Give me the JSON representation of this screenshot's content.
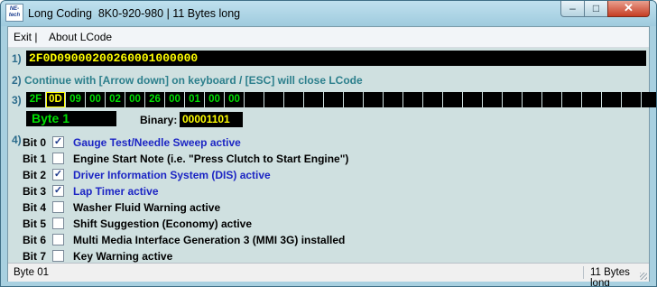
{
  "window": {
    "icon_text": "NE-tech",
    "title": "Long Coding  8K0-920-980 | 11 Bytes long",
    "minimize": "–",
    "maximize": "□",
    "close": "✕"
  },
  "menu": {
    "exit": "Exit |",
    "about": "About LCode"
  },
  "steps": {
    "s1": "1)",
    "s2": "2)",
    "s3": "3)",
    "s4": "4)"
  },
  "coding_string": "2F0D09000200260001000000",
  "instruction": "Continue with [Arrow down] on keyboard / [ESC] will close LCode",
  "bytes": [
    "2F",
    "0D",
    "09",
    "00",
    "02",
    "00",
    "26",
    "00",
    "01",
    "00",
    "00",
    "",
    "",
    "",
    "",
    "",
    "",
    "",
    "",
    "",
    "",
    "",
    "",
    "",
    "",
    "",
    "",
    "",
    "",
    "",
    "",
    ""
  ],
  "selected_byte_index": 1,
  "byte_label": "Byte 1",
  "binary_label": "Binary:",
  "binary_value": "00001101",
  "bits": [
    {
      "name": "Bit 0",
      "checked": true,
      "mark": "✓",
      "desc": "Gauge Test/Needle Sweep active"
    },
    {
      "name": "Bit 1",
      "checked": false,
      "mark": "",
      "desc": "Engine Start Note (i.e. \"Press Clutch to Start Engine\")"
    },
    {
      "name": "Bit 2",
      "checked": true,
      "mark": "✓",
      "desc": "Driver Information System (DIS) active"
    },
    {
      "name": "Bit 3",
      "checked": true,
      "mark": "✓",
      "desc": "Lap Timer active"
    },
    {
      "name": "Bit 4",
      "checked": false,
      "mark": "",
      "desc": "Washer Fluid Warning active"
    },
    {
      "name": "Bit 5",
      "checked": false,
      "mark": "",
      "desc": "Shift Suggestion (Economy) active"
    },
    {
      "name": "Bit 6",
      "checked": false,
      "mark": "",
      "desc": "Multi Media Interface Generation 3 (MMI 3G) installed"
    },
    {
      "name": "Bit 7",
      "checked": false,
      "mark": "",
      "desc": "Key Warning active"
    }
  ],
  "status": {
    "left": "Byte 01",
    "right": "11 Bytes long"
  },
  "colors": {
    "title_bar": "#a8d0e0",
    "panel": "#cfe0e0",
    "field_bg": "#000000",
    "byte_text": "#00e000",
    "hex_text": "#ffff00",
    "bit_on": "#1c25c4"
  }
}
